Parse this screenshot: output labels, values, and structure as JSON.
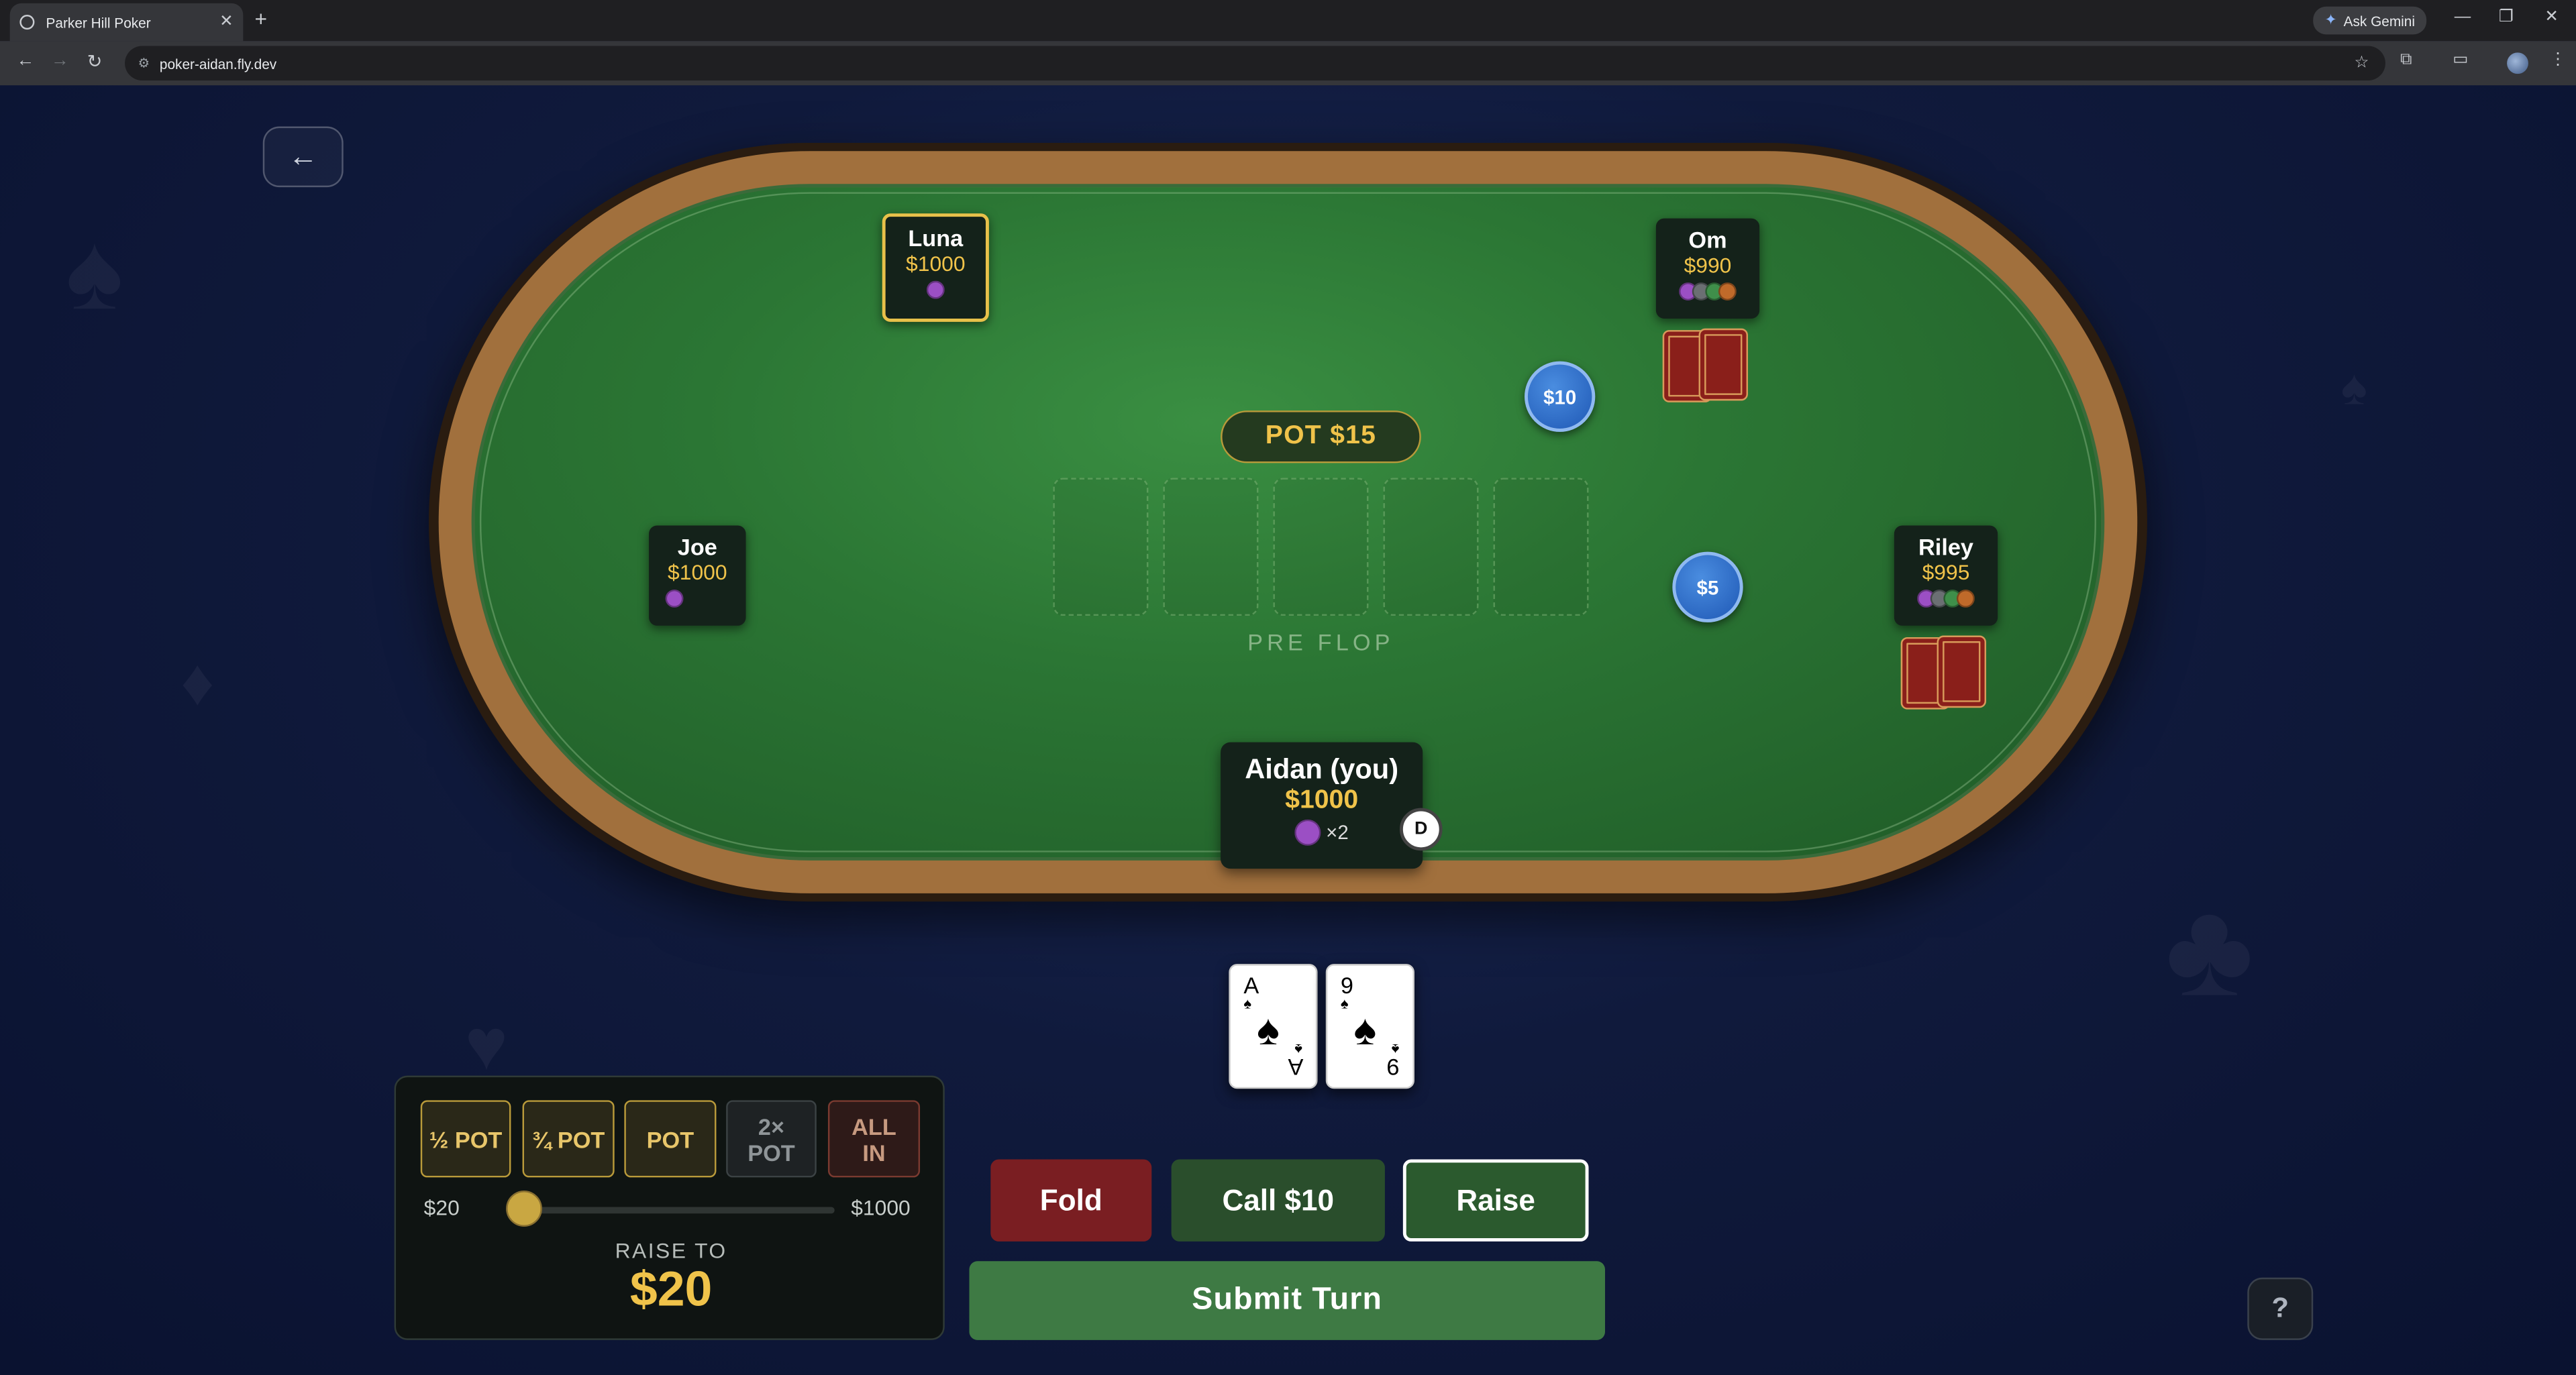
{
  "browser": {
    "tab_title": "Parker Hill Poker",
    "url": "poker-aidan.fly.dev",
    "gemini_label": "Ask Gemini"
  },
  "icons": {
    "back": "←",
    "close": "✕",
    "new_tab": "+",
    "star": "☆",
    "help": "?"
  },
  "players": {
    "luna": {
      "name": "Luna",
      "stack": "$1000",
      "chip_colors": [
        "#9b4fc4"
      ]
    },
    "om": {
      "name": "Om",
      "stack": "$990",
      "chip_colors": [
        "#9b4fc4",
        "#6b6f73",
        "#3f8f4a",
        "#c06a2a"
      ]
    },
    "joe": {
      "name": "Joe",
      "stack": "$1000",
      "chip_colors": [
        "#9b4fc4"
      ]
    },
    "riley": {
      "name": "Riley",
      "stack": "$995",
      "chip_colors": [
        "#9b4fc4",
        "#6b6f73",
        "#3f8f4a",
        "#c06a2a"
      ]
    },
    "me": {
      "name": "Aidan (you)",
      "stack": "$1000",
      "chip_color": "#9b4fc4",
      "chip_count": "×2"
    }
  },
  "bets": {
    "om": "$10",
    "riley": "$5"
  },
  "pot": "POT $15",
  "stage": "PRE FLOP",
  "dealer_button": "D",
  "hole_cards": [
    {
      "rank": "A",
      "suit": "♠"
    },
    {
      "rank": "9",
      "suit": "♠"
    }
  ],
  "raise_panel": {
    "presets": [
      "½ POT",
      "¾ POT",
      "POT",
      "2× POT",
      "ALL IN"
    ],
    "min": "$20",
    "max": "$1000",
    "raise_to_label": "RAISE TO",
    "raise_amount": "$20",
    "slider_fraction": 0
  },
  "actions": {
    "fold": "Fold",
    "call": "Call $10",
    "raise": "Raise",
    "submit": "Submit Turn"
  },
  "colors": {
    "accent_gold": "#f0c34a",
    "felt": "#2b7634",
    "fold": "#7a1e22",
    "call": "#2a4e2c",
    "submit": "#3e7a44"
  }
}
